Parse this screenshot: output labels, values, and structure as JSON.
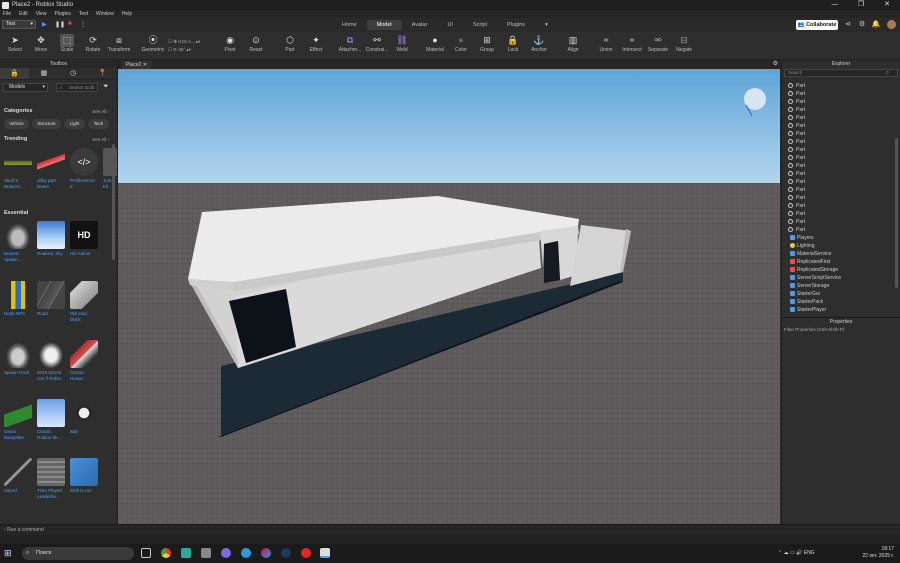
{
  "window": {
    "title": "Place2 - Roblox Studio",
    "controls": [
      "—",
      "❐",
      "✕"
    ]
  },
  "menu": [
    "File",
    "Edit",
    "View",
    "Plugins",
    "Test",
    "Window",
    "Help"
  ],
  "topbar": {
    "mode_select": "Test",
    "ribbon_tabs": [
      "Home",
      "Model",
      "Avatar",
      "UI",
      "Script",
      "Plugins",
      "▾"
    ],
    "active_tab": "Model",
    "collaborate_label": "Collaborate"
  },
  "toolbar": {
    "tools": [
      "Select",
      "Move",
      "Scale",
      "Rotate",
      "Transform",
      "Geometric",
      "Pivot",
      "Reset",
      "Part",
      "Effect",
      "Attachm...",
      "Constrai...",
      "Weld",
      "Material",
      "Color",
      "Group",
      "Lock",
      "Anchor",
      "Align",
      "Union",
      "Intersect",
      "Separate",
      "Negate"
    ],
    "move_step": "0.01 s...",
    "rotate_step": "45°"
  },
  "doc_tab": "Place2",
  "toolbox": {
    "title": "Toolbox",
    "category_select": "Models",
    "search_placeholder": "Search toolb",
    "categories_title": "Categories",
    "see_all": "See All",
    "chips": [
      "Vehicle",
      "Structure",
      "Light",
      "Tech"
    ],
    "trending_title": "Trending",
    "trending": [
      "Skull X\nBrainrot ...",
      "obby part\nlasers",
      "ProfileServic\ne",
      "Jum\nKit"
    ],
    "essential_title": "Essential",
    "essential": [
      "Neutral\nSpawn...",
      "Realistic Sky",
      "HD Admin",
      "Noob NPC",
      "Road",
      "Old stud\nblock",
      "Spawn Point",
      "2019 Sports\nCar // Roblo",
      "Classic\nHouse",
      "Grass\nBaseplate",
      "Classic\nRoblox Sk...",
      "Ball",
      "Sword",
      "Time Played\nLeaderbo...",
      "Shift to run"
    ]
  },
  "explorer": {
    "title": "Explorer",
    "search_placeholder": "Search",
    "parts": [
      "Part",
      "Part",
      "Part",
      "Part",
      "Part",
      "Part",
      "Part",
      "Part",
      "Part",
      "Part",
      "Part",
      "Part",
      "Part",
      "Part",
      "Part",
      "Part",
      "Part",
      "Part",
      "Part"
    ],
    "services": [
      "Players",
      "Lighting",
      "MaterialService",
      "ReplicatedFirst",
      "ReplicatedStorage",
      "ServerScriptService",
      "ServerStorage",
      "StarterGui",
      "StarterPack",
      "StarterPlayer"
    ]
  },
  "properties": {
    "title": "Properties",
    "filter_placeholder": "Filter Properties (Ctrl+Shift+P)"
  },
  "command_bar": {
    "placeholder": "Run a command"
  },
  "taskbar": {
    "search_label": "Поиск",
    "lang": "ENG",
    "time": "18:17",
    "date": "22 окт. 2025 г."
  }
}
